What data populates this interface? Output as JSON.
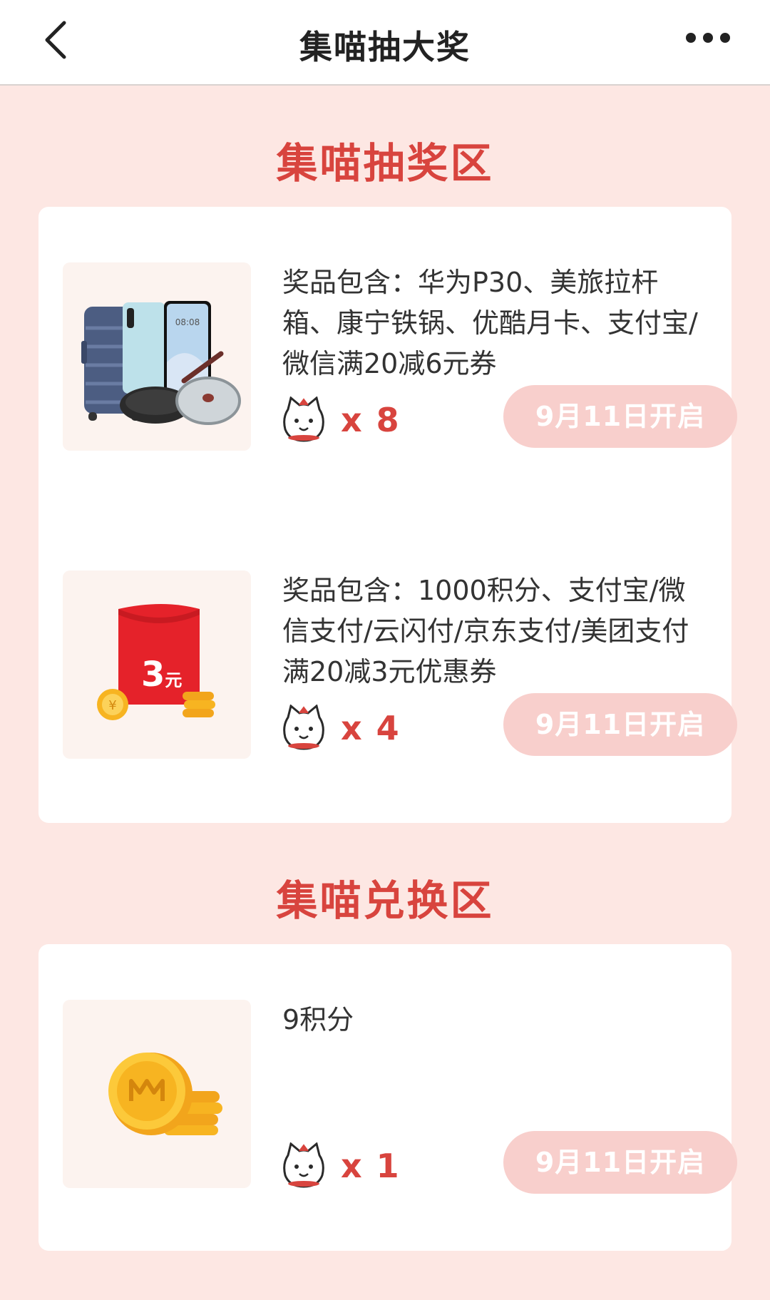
{
  "header": {
    "title": "集喵抽大奖"
  },
  "lottery_section": {
    "title": "集喵抽奖区",
    "items": [
      {
        "image_icon": "luggage-phone-pan-image",
        "description": "奖品包含：华为P30、美旅拉杆箱、康宁铁锅、优酷月卡、支付宝/微信满20减6元券",
        "count": "x 8",
        "button": "9月11日开启"
      },
      {
        "image_icon": "red-envelope-3-yuan-image",
        "description": "奖品包含：1000积分、支付宝/微信支付/云闪付/京东支付/美团支付满20减3元优惠券",
        "count": "x 4",
        "button": "9月11日开启",
        "envelope_text": "3",
        "envelope_unit": "元"
      }
    ]
  },
  "exchange_section": {
    "title": "集喵兑换区",
    "items": [
      {
        "image_icon": "gold-coin-image",
        "description": "9积分",
        "count": "x 1",
        "button": "9月11日开启"
      }
    ]
  },
  "colors": {
    "accent": "#d8443e",
    "background": "#fde7e3",
    "button_bg": "#f8cfcc"
  }
}
